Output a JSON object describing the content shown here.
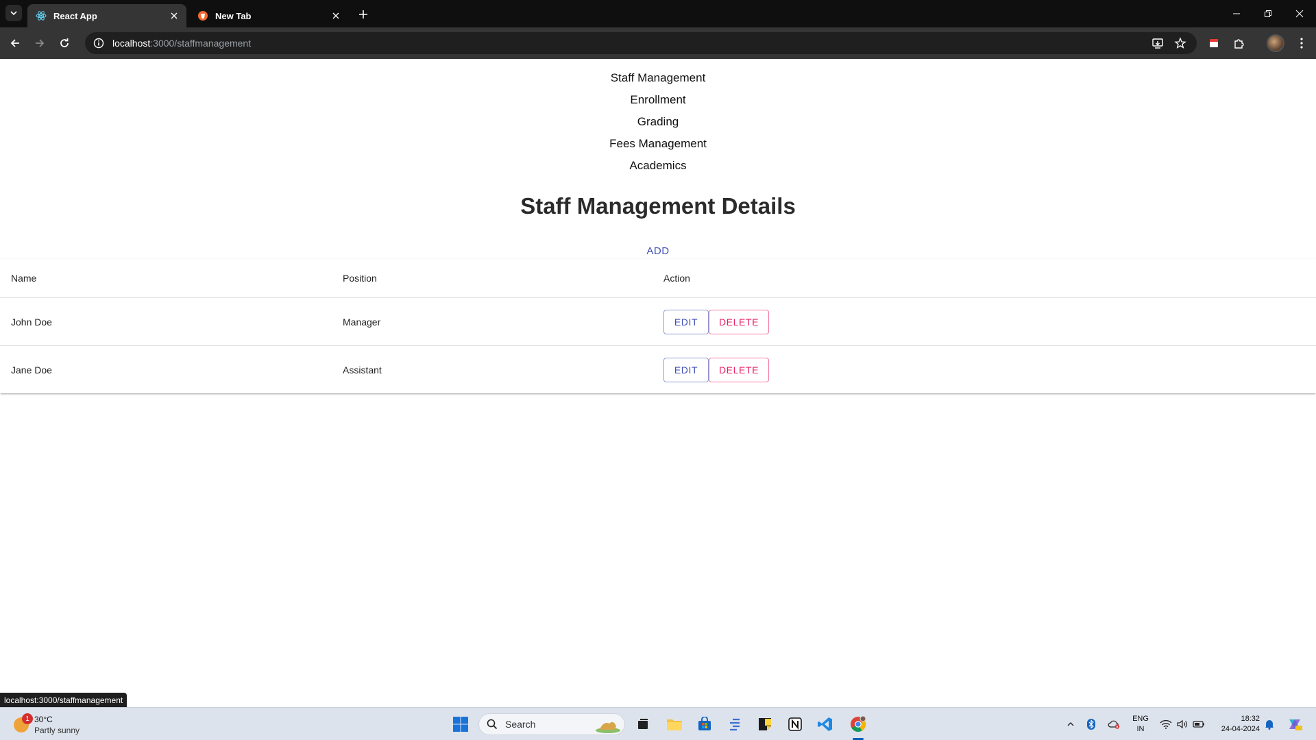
{
  "browser": {
    "tabs": [
      {
        "title": "React App",
        "active": true,
        "favicon": "react-icon"
      },
      {
        "title": "New Tab",
        "active": false,
        "favicon": "brave-icon"
      }
    ],
    "url_host": "localhost",
    "url_path": ":3000/staffmanagement"
  },
  "nav": {
    "links": [
      "Staff Management",
      "Enrollment",
      "Grading",
      "Fees Management",
      "Academics"
    ]
  },
  "page": {
    "title": "Staff Management Details",
    "add_label": "ADD"
  },
  "table": {
    "headers": [
      "Name",
      "Position",
      "Action"
    ],
    "rows": [
      {
        "name": "John Doe",
        "position": "Manager"
      },
      {
        "name": "Jane Doe",
        "position": "Assistant"
      }
    ],
    "edit_label": "EDIT",
    "delete_label": "DELETE"
  },
  "status_tooltip": "localhost:3000/staffmanagement",
  "taskbar": {
    "weather_temp": "30°C",
    "weather_condition": "Partly sunny",
    "weather_badge": "1",
    "search_placeholder": "Search",
    "lang_line1": "ENG",
    "lang_line2": "IN",
    "time": "18:32",
    "date": "24-04-2024"
  },
  "colors": {
    "primary": "#3f51b5",
    "secondary": "#e91e63",
    "chrome_bg": "#0f0f0f",
    "toolbar_bg": "#353535",
    "taskbar_bg": "#dde3ec"
  }
}
